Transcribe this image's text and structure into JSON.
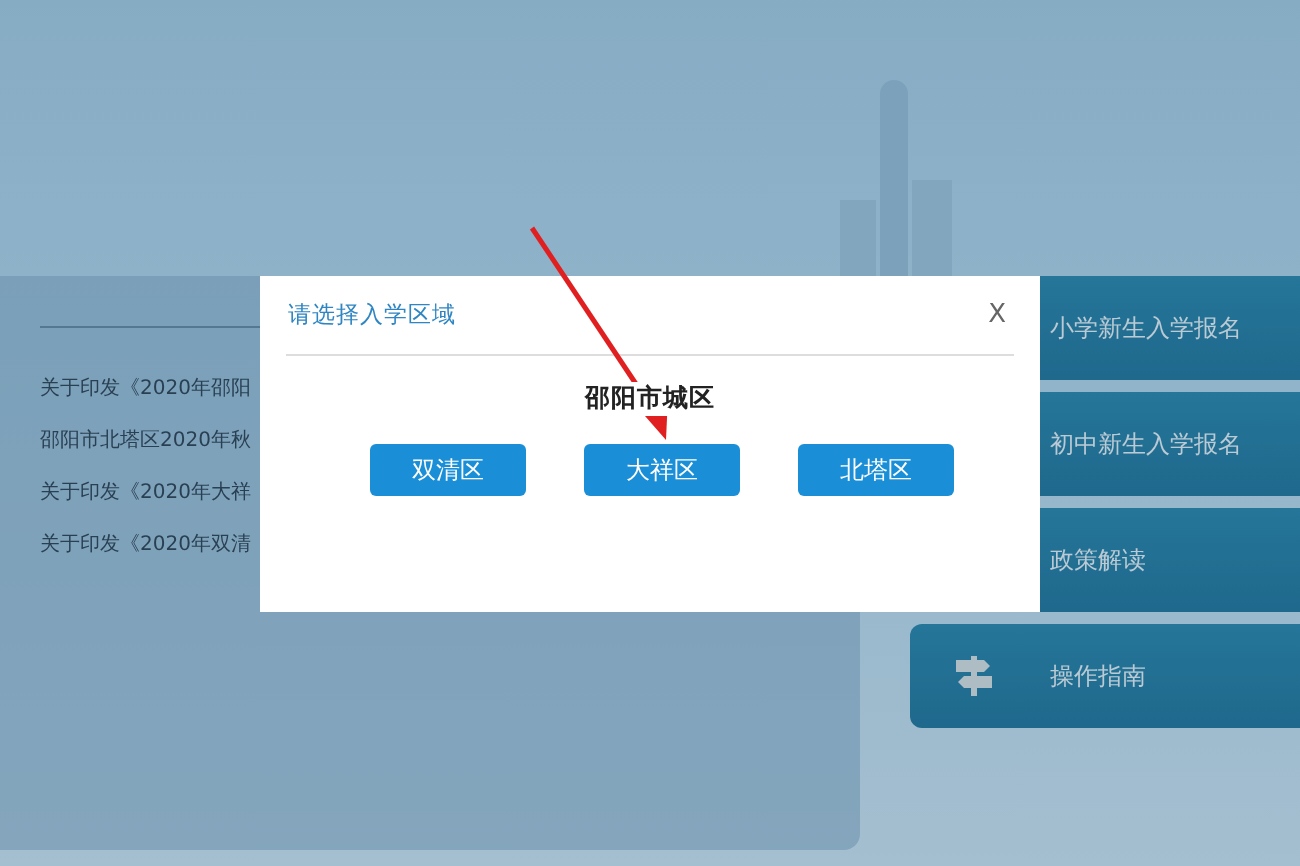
{
  "news_list": [
    "关于印发《2020年邵阳",
    "邵阳市北塔区2020年秋",
    "关于印发《2020年大祥",
    "关于印发《2020年双清"
  ],
  "menu_buttons": [
    {
      "label": "小学新生入学报名",
      "kind": "plain"
    },
    {
      "label": "初中新生入学报名",
      "kind": "plain"
    },
    {
      "label": "政策解读",
      "kind": "plain"
    },
    {
      "label": "操作指南",
      "kind": "signpost"
    }
  ],
  "dialog": {
    "title": "请选择入学区域",
    "close": "X",
    "heading": "邵阳市城区",
    "buttons": [
      "双清区",
      "大祥区",
      "北塔区"
    ]
  },
  "annotation": {
    "kind": "arrow"
  }
}
